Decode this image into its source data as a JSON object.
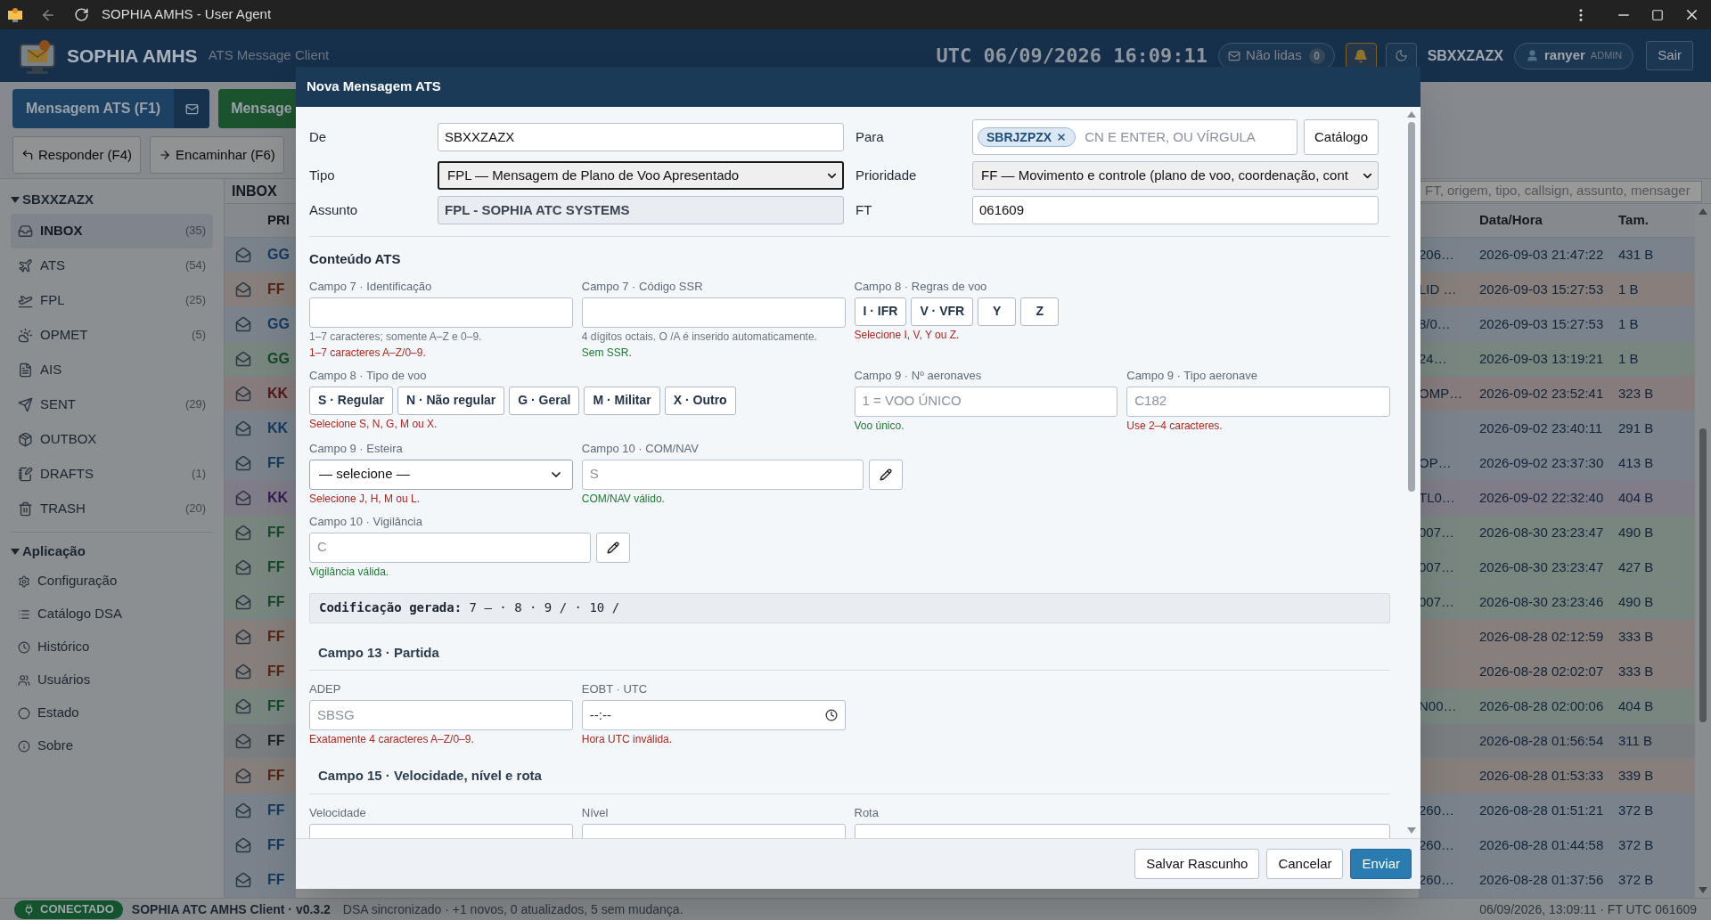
{
  "titlebar": {
    "title": "SOPHIA AMHS - User Agent"
  },
  "header": {
    "app_name": "SOPHIA AMHS",
    "subtitle": "ATS Message Client",
    "clock": "UTC 06/09/2026 16:09:11",
    "unread_label": "Não lidas",
    "unread_count": "0",
    "alerts_on": true,
    "station": "SBXXZAZX",
    "user": "ranyer",
    "role": "ADMIN",
    "logout": "Sair"
  },
  "toolbar": {
    "primary": [
      {
        "label": "Mensagem ATS (F1)",
        "kind": "primary"
      },
      {
        "label": "Mensage",
        "kind": "success"
      }
    ],
    "secondary": [
      {
        "label": "Responder (F4)",
        "kind": "reply"
      },
      {
        "label": "Encaminhar (F6)",
        "kind": "forward"
      }
    ]
  },
  "sidebar": {
    "groups": [
      {
        "title": "SBXXZAZX",
        "expanded": true,
        "items": [
          {
            "label": "INBOX",
            "count": "(35)",
            "selected": true
          },
          {
            "label": "ATS",
            "count": "(54)",
            "selected": false
          },
          {
            "label": "FPL",
            "count": "(25)",
            "selected": false
          },
          {
            "label": "OPMET",
            "count": "(5)",
            "selected": false
          },
          {
            "label": "AIS",
            "selected": false
          },
          {
            "label": "SENT",
            "count": "(29)",
            "selected": false
          },
          {
            "label": "OUTBOX",
            "selected": false
          },
          {
            "label": "DRAFTS",
            "count": "(1)",
            "selected": false
          },
          {
            "label": "TRASH",
            "count": "(20)",
            "selected": false
          }
        ]
      },
      {
        "title": "Aplicação",
        "expanded": true,
        "items": [
          {
            "label": "Configuração",
            "selected": false
          },
          {
            "label": "Catálogo DSA",
            "selected": false
          },
          {
            "label": "Histórico",
            "selected": false
          },
          {
            "label": "Usuários",
            "selected": false
          },
          {
            "label": "Estado",
            "selected": false
          },
          {
            "label": "Sobre",
            "selected": false
          }
        ]
      }
    ]
  },
  "table": {
    "title": "INBOX",
    "search_placeholder": "FT, origem, tipo, callsign, assunto, mensager",
    "columns": {
      "priority": "PRI",
      "date": "Data/Hora",
      "size": "Tam."
    },
    "rows": [
      {
        "priority": "GG",
        "color": "#13395f",
        "column_3": "206…",
        "date": "2026-09-03 21:47:22",
        "size": "431 B"
      },
      {
        "priority": "FF",
        "color": "#532311",
        "column_3": "LID …",
        "date": "2026-09-03 15:27:53",
        "size": "1 B"
      },
      {
        "priority": "GG",
        "color": "#13395f",
        "column_3": "8/0…",
        "date": "2026-09-03 15:27:53",
        "size": "1 B"
      },
      {
        "priority": "GG",
        "color": "#124923",
        "column_3": "24…",
        "date": "2026-09-03 13:19:21",
        "size": "1 B"
      },
      {
        "priority": "KK",
        "color": "#531616",
        "column_3": "OMP…",
        "date": "2026-09-02 23:52:41",
        "size": "323 B"
      },
      {
        "priority": "KK",
        "color": "#13395f",
        "date": "2026-09-02 23:40:11",
        "size": "291 B"
      },
      {
        "priority": "FF",
        "color": "#13395f",
        "column_3": "OP…",
        "date": "2026-09-02 23:37:30",
        "size": "413 B"
      },
      {
        "priority": "KK",
        "color": "#361b54",
        "column_3": "TL0…",
        "date": "2026-09-02 22:32:40",
        "size": "404 B"
      },
      {
        "priority": "FF",
        "color": "#124923",
        "column_3": "007…",
        "date": "2026-08-30 23:23:47",
        "size": "490 B"
      },
      {
        "priority": "FF",
        "color": "#124923",
        "column_3": "007…",
        "date": "2026-08-30 23:23:47",
        "size": "427 B"
      },
      {
        "priority": "FF",
        "color": "#124923",
        "column_3": "007…",
        "date": "2026-08-30 23:23:46",
        "size": "490 B"
      },
      {
        "priority": "FF",
        "color": "#532311",
        "date": "2026-08-28 02:12:59",
        "size": "333 B"
      },
      {
        "priority": "FF",
        "color": "#532311",
        "date": "2026-08-28 02:02:07",
        "size": "333 B"
      },
      {
        "priority": "FF",
        "color": "#124923",
        "column_3": "N00…",
        "date": "2026-08-28 02:00:06",
        "size": "404 B"
      },
      {
        "priority": "FF",
        "color": "#1c2026",
        "date": "2026-08-28 01:56:54",
        "size": "311 B"
      },
      {
        "priority": "FF",
        "color": "#532311",
        "date": "2026-08-28 01:53:33",
        "size": "339 B"
      },
      {
        "priority": "FF",
        "color": "#13395f",
        "column_3": "260…",
        "date": "2026-08-28 01:51:21",
        "size": "372 B"
      },
      {
        "priority": "FF",
        "color": "#13395f",
        "column_3": "260…",
        "date": "2026-08-28 01:44:58",
        "size": "372 B"
      },
      {
        "priority": "FF",
        "color": "#13395f",
        "column_3": "260…",
        "date": "2026-08-28 01:37:56",
        "size": "372 B"
      }
    ]
  },
  "modal": {
    "title": "Nova Mensagem ATS",
    "header_fields": [
      {
        "label": "De",
        "kind": "text",
        "value": "SBXXZAZX",
        "focused": false
      },
      {
        "label": "Para",
        "kind": "recipients",
        "chips": [
          "SBRJZPZX"
        ],
        "placeholder": "CN E ENTER, OU VÍRGULA",
        "button": "Catálogo",
        "focused": false
      },
      {
        "label": "Tipo",
        "kind": "select",
        "value": "FPL — Mensagem de Plano de Voo Apresentado",
        "focused": true
      },
      {
        "label": "Prioridade",
        "kind": "select",
        "value": "FF — Movimento e controle (plano de voo, coordenação, cont",
        "focused": false
      },
      {
        "label": "Assunto",
        "kind": "readonly",
        "value": "FPL - SOPHIA ATC SYSTEMS",
        "focused": false
      },
      {
        "label": "FT",
        "kind": "text",
        "value": "061609",
        "focused": false
      }
    ],
    "content_title": "Conteúdo ATS",
    "content_rows": [
      [
        {
          "label": "Campo 7 · Identificação",
          "kind": "text",
          "hints": [
            {
              "text": "1–7 caracteres; somente A–Z e 0–9.",
              "color": "#6b7580"
            },
            {
              "text": "1–7 caracteres A–Z/0–9.",
              "color": "#b3261e"
            }
          ]
        },
        {
          "label": "Campo 7 · Código SSR",
          "kind": "text",
          "hints": [
            {
              "text": "4 dígitos octais. O /A é inserido automaticamente.",
              "color": "#6b7580"
            },
            {
              "text": "Sem SSR.",
              "color": "#1e7a34"
            }
          ]
        },
        {
          "label": "Campo 8 · Regras de voo",
          "kind": "choices",
          "options": [
            {
              "label": "I · IFR",
              "selected": false
            },
            {
              "label": "V · VFR",
              "selected": false
            },
            {
              "label": "Y",
              "selected": false
            },
            {
              "label": "Z",
              "selected": false
            }
          ],
          "hints": [
            {
              "text": "Selecione I, V, Y ou Z.",
              "color": "#b3261e"
            }
          ]
        }
      ],
      [
        {
          "label": "Campo 8 · Tipo de voo",
          "kind": "choices",
          "options": [
            {
              "label": "S · Regular",
              "selected": false
            },
            {
              "label": "N · Não regular",
              "selected": false
            },
            {
              "label": "G · Geral",
              "selected": false
            },
            {
              "label": "M · Militar",
              "selected": false
            },
            {
              "label": "X · Outro",
              "selected": false
            }
          ],
          "hints": [
            {
              "text": "Selecione S, N, G, M ou X.",
              "color": "#b3261e"
            }
          ]
        },
        {
          "label": "Campo 9 · Nº aeronaves",
          "kind": "text",
          "placeholder": "1 = VOO ÚNICO",
          "hints": [
            {
              "text": "Voo único.",
              "color": "#1e7a34"
            }
          ]
        },
        {
          "label": "Campo 9 · Tipo aeronave",
          "kind": "text",
          "placeholder": "C182",
          "hints": [
            {
              "text": "Use 2–4 caracteres.",
              "color": "#b3261e"
            }
          ]
        }
      ],
      [
        {
          "label": "Campo 9 · Esteira",
          "kind": "select",
          "value": "— selecione —",
          "hints": [
            {
              "text": "Selecione J, H, M ou L.",
              "color": "#b3261e"
            }
          ]
        },
        {
          "label": "Campo 10 · COM/NAV",
          "kind": "edit",
          "placeholder": "S",
          "hints": [
            {
              "text": "COM/NAV válido.",
              "color": "#1e7a34"
            }
          ]
        }
      ],
      [
        {
          "label": "Campo 10 · Vigilância",
          "kind": "edit",
          "placeholder": "C",
          "hints": [
            {
              "text": "Vigilância válida.",
              "color": "#1e7a34"
            }
          ]
        }
      ]
    ],
    "encoding": "**Codificação gerada:** 7 — · 8 · 9 / · 10 /",
    "sections": [
      {
        "title": "Campo 13 · Partida",
        "fields": [
          {
            "label": "ADEP",
            "kind": "text",
            "placeholder": "SBSG",
            "hints": [
              {
                "text": "Exatamente 4 caracteres A–Z/0–9.",
                "color": "#b3261e"
              }
            ]
          },
          {
            "label": "EOBT · UTC",
            "kind": "time",
            "placeholder": "--:--",
            "hints": [
              {
                "text": "Hora UTC inválida.",
                "color": "#b3261e"
              }
            ]
          }
        ]
      },
      {
        "title": "Campo 15 · Velocidade, nível e rota",
        "fields": [
          {
            "label": "Velocidade",
            "kind": "text"
          },
          {
            "label": "Nível",
            "kind": "text"
          },
          {
            "label": "Rota",
            "kind": "textarea"
          }
        ]
      }
    ],
    "buttons": [
      {
        "label": "Salvar Rascunho",
        "kind": "secondary"
      },
      {
        "label": "Cancelar",
        "kind": "secondary"
      },
      {
        "label": "Enviar",
        "kind": "primary"
      }
    ]
  },
  "status_bar": {
    "connection": "CONECTADO",
    "app": "SOPHIA ATC AMHS Client · v0.3.2",
    "sync": "DSA sincronizado · +1 novos, 0 atualizados, 5 sem mudança.",
    "right": "06/09/2026, 13:09:11 · FT UTC 061609"
  }
}
